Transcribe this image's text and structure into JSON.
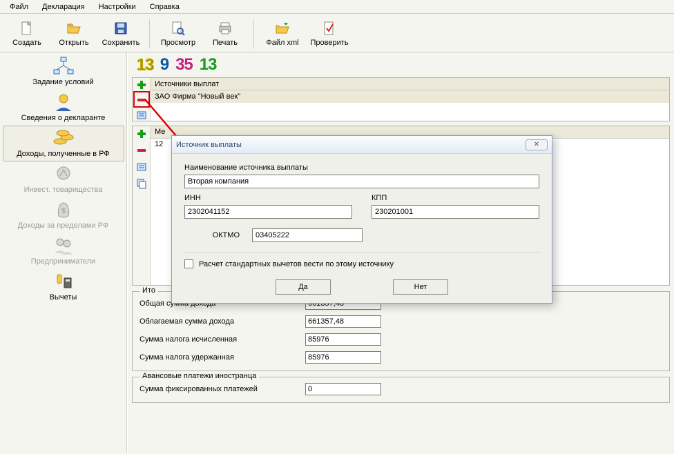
{
  "menu": {
    "file": "Файл",
    "declaration": "Декларация",
    "settings": "Настройки",
    "help": "Справка"
  },
  "toolbar": {
    "create": "Создать",
    "open": "Открыть",
    "save": "Сохранить",
    "view": "Просмотр",
    "print": "Печать",
    "filexml": "Файл xml",
    "check": "Проверить"
  },
  "sidebar": {
    "task": "Задание условий",
    "declarant": "Сведения о декларанте",
    "income_rf": "Доходы, полученные в РФ",
    "invest": "Инвест. товарищества",
    "income_outside": "Доходы за пределами РФ",
    "entrepreneurs": "Предприниматели",
    "deductions": "Вычеты"
  },
  "rates": {
    "r1": "13",
    "r2": "9",
    "r3": "35",
    "r4": "13"
  },
  "sources": {
    "header": "Источники выплат",
    "row1": "ЗАО Фирма \"Новый век\""
  },
  "months": {
    "head_month": "Ме",
    "row1_month": "12"
  },
  "totals": {
    "legend": "Ито",
    "total_income_label": "Общая сумма дохода",
    "total_income": "661357,48",
    "taxable_income_label": "Облагаемая сумма дохода",
    "taxable_income": "661357,48",
    "tax_calc_label": "Сумма налога исчисленная",
    "tax_calc": "85976",
    "tax_withheld_label": "Сумма налога удержанная",
    "tax_withheld": "85976"
  },
  "advance": {
    "legend": "Авансовые платежи иностранца",
    "fixed_label": "Сумма фиксированных платежей",
    "fixed": "0"
  },
  "dialog": {
    "title": "Источник выплаты",
    "name_label": "Наименование источника выплаты",
    "name": "Вторая компания",
    "inn_label": "ИНН",
    "inn": "2302041152",
    "kpp_label": "КПП",
    "kpp": "230201001",
    "oktmo_label": "ОКТМО",
    "oktmo": "03405222",
    "stdded": "Расчет стандартных вычетов вести по этому источнику",
    "yes": "Да",
    "no": "Нет",
    "close": "✕"
  }
}
